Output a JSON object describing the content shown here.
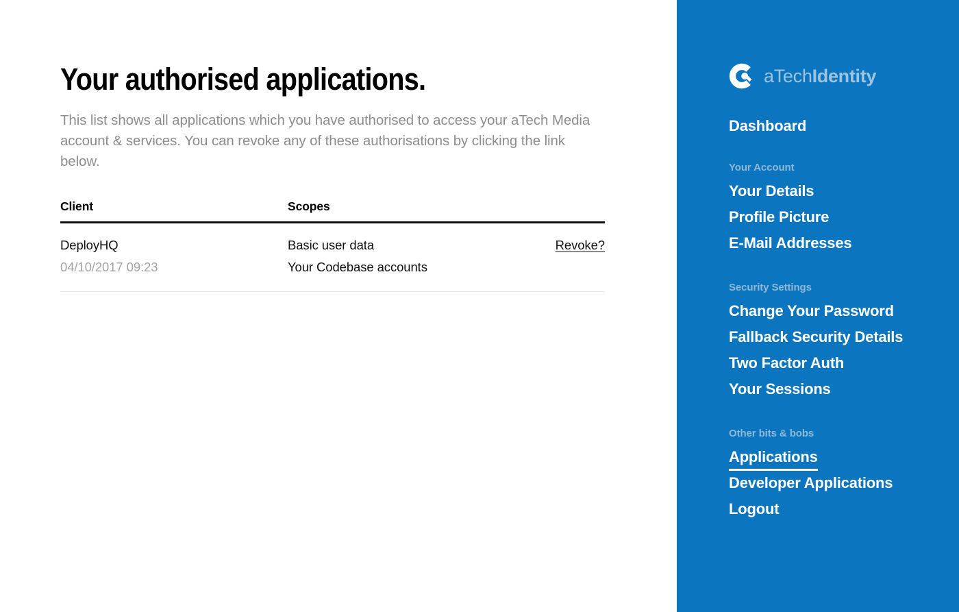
{
  "main": {
    "title": "Your authorised applications.",
    "intro": "This list shows all applications which you have authorised to access your aTech Media account & services. You can revoke any of these authorisations by clicking the link below.",
    "table": {
      "headers": {
        "client": "Client",
        "scopes": "Scopes",
        "actions": ""
      },
      "rows": [
        {
          "client_name": "DeployHQ",
          "client_date": "04/10/2017 09:23",
          "scopes": [
            "Basic user data",
            "Your Codebase accounts"
          ],
          "action_label": "Revoke?"
        }
      ]
    }
  },
  "sidebar": {
    "accent_color": "#0b76bf",
    "brand": {
      "icon": "atech-circle-logo-icon",
      "text_light": "aTech",
      "text_bold": "Identity"
    },
    "dashboard_label": "Dashboard",
    "groups": [
      {
        "title": "Your Account",
        "items": [
          {
            "label": "Your Details",
            "active": false
          },
          {
            "label": "Profile Picture",
            "active": false
          },
          {
            "label": "E-Mail Addresses",
            "active": false
          }
        ]
      },
      {
        "title": "Security Settings",
        "items": [
          {
            "label": "Change Your Password",
            "active": false
          },
          {
            "label": "Fallback Security Details",
            "active": false
          },
          {
            "label": "Two Factor Auth",
            "active": false
          },
          {
            "label": "Your Sessions",
            "active": false
          }
        ]
      },
      {
        "title": "Other bits & bobs",
        "items": [
          {
            "label": "Applications",
            "active": true
          },
          {
            "label": "Developer Applications",
            "active": false
          },
          {
            "label": "Logout",
            "active": false
          }
        ]
      }
    ]
  }
}
